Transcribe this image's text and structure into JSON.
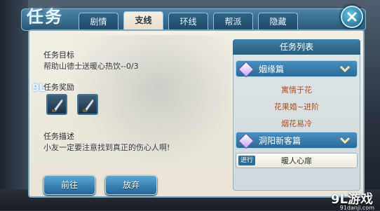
{
  "header": {
    "title": "任务",
    "tabs": [
      {
        "label": "剧情",
        "active": false
      },
      {
        "label": "支线",
        "active": true
      },
      {
        "label": "环线",
        "active": false
      },
      {
        "label": "帮派",
        "active": false
      },
      {
        "label": "隐藏",
        "active": false
      }
    ],
    "close_icon": "close-icon"
  },
  "detail": {
    "goal_label": "任务目标",
    "goal_value": "帮助山德士送暖心热饮--0/3",
    "reward_label": "任务奖励",
    "rewards": [
      {
        "icon": "reward-item-icon"
      },
      {
        "icon": "reward-item-icon"
      }
    ],
    "desc_label": "任务描述",
    "desc_value": "小友一定要注意找到真正的伤心人啊!",
    "go_button": "前往",
    "abandon_button": "放弃"
  },
  "task_list": {
    "header": "任务列表",
    "categories": [
      {
        "label": "姻缘篇",
        "items": [
          "寓情于花",
          "花果婚~进阶",
          "烟花易冷"
        ]
      },
      {
        "label": "洞阳新客篇",
        "items": [
          {
            "badge": "进行",
            "label": "暖人心扉",
            "selected": true
          }
        ]
      }
    ]
  },
  "watermark": {
    "logo_text": "9L",
    "brand": "9L游戏",
    "url": "91danji.com"
  },
  "colors": {
    "accent": "#2c6a98",
    "panel": "#f0ece2",
    "quest_item_text": "#b24f22"
  }
}
